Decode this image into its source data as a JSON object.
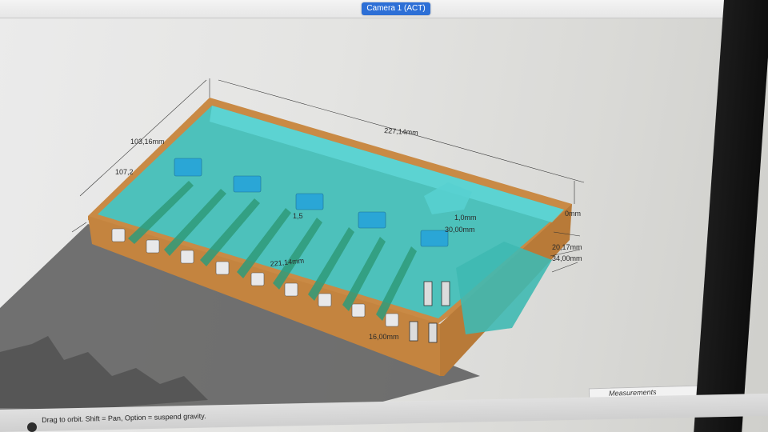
{
  "header": {
    "camera_tab": "Camera 1 (ACT)"
  },
  "model": {
    "colors": {
      "wood": "#c98a45",
      "glass": "#3fc6c8",
      "shadow": "#5a5a5a",
      "part": "#2aa6d6"
    },
    "dimensions": {
      "length": "227,14mm",
      "depth": "103,16mm",
      "depth_partial": "107,2",
      "inner_length": "221,14mm",
      "right_top": "0mm",
      "right_mid": "20,17mm",
      "right_low": "34,00mm",
      "inner_height": "30,00mm",
      "inner_small": "1,0mm",
      "bottom_small": "16,00mm",
      "mid_small": "1,5"
    }
  },
  "status_bar": {
    "hint": "Drag to orbit. Shift = Pan, Option = suspend gravity."
  },
  "measurements": {
    "label": "Measurements"
  }
}
